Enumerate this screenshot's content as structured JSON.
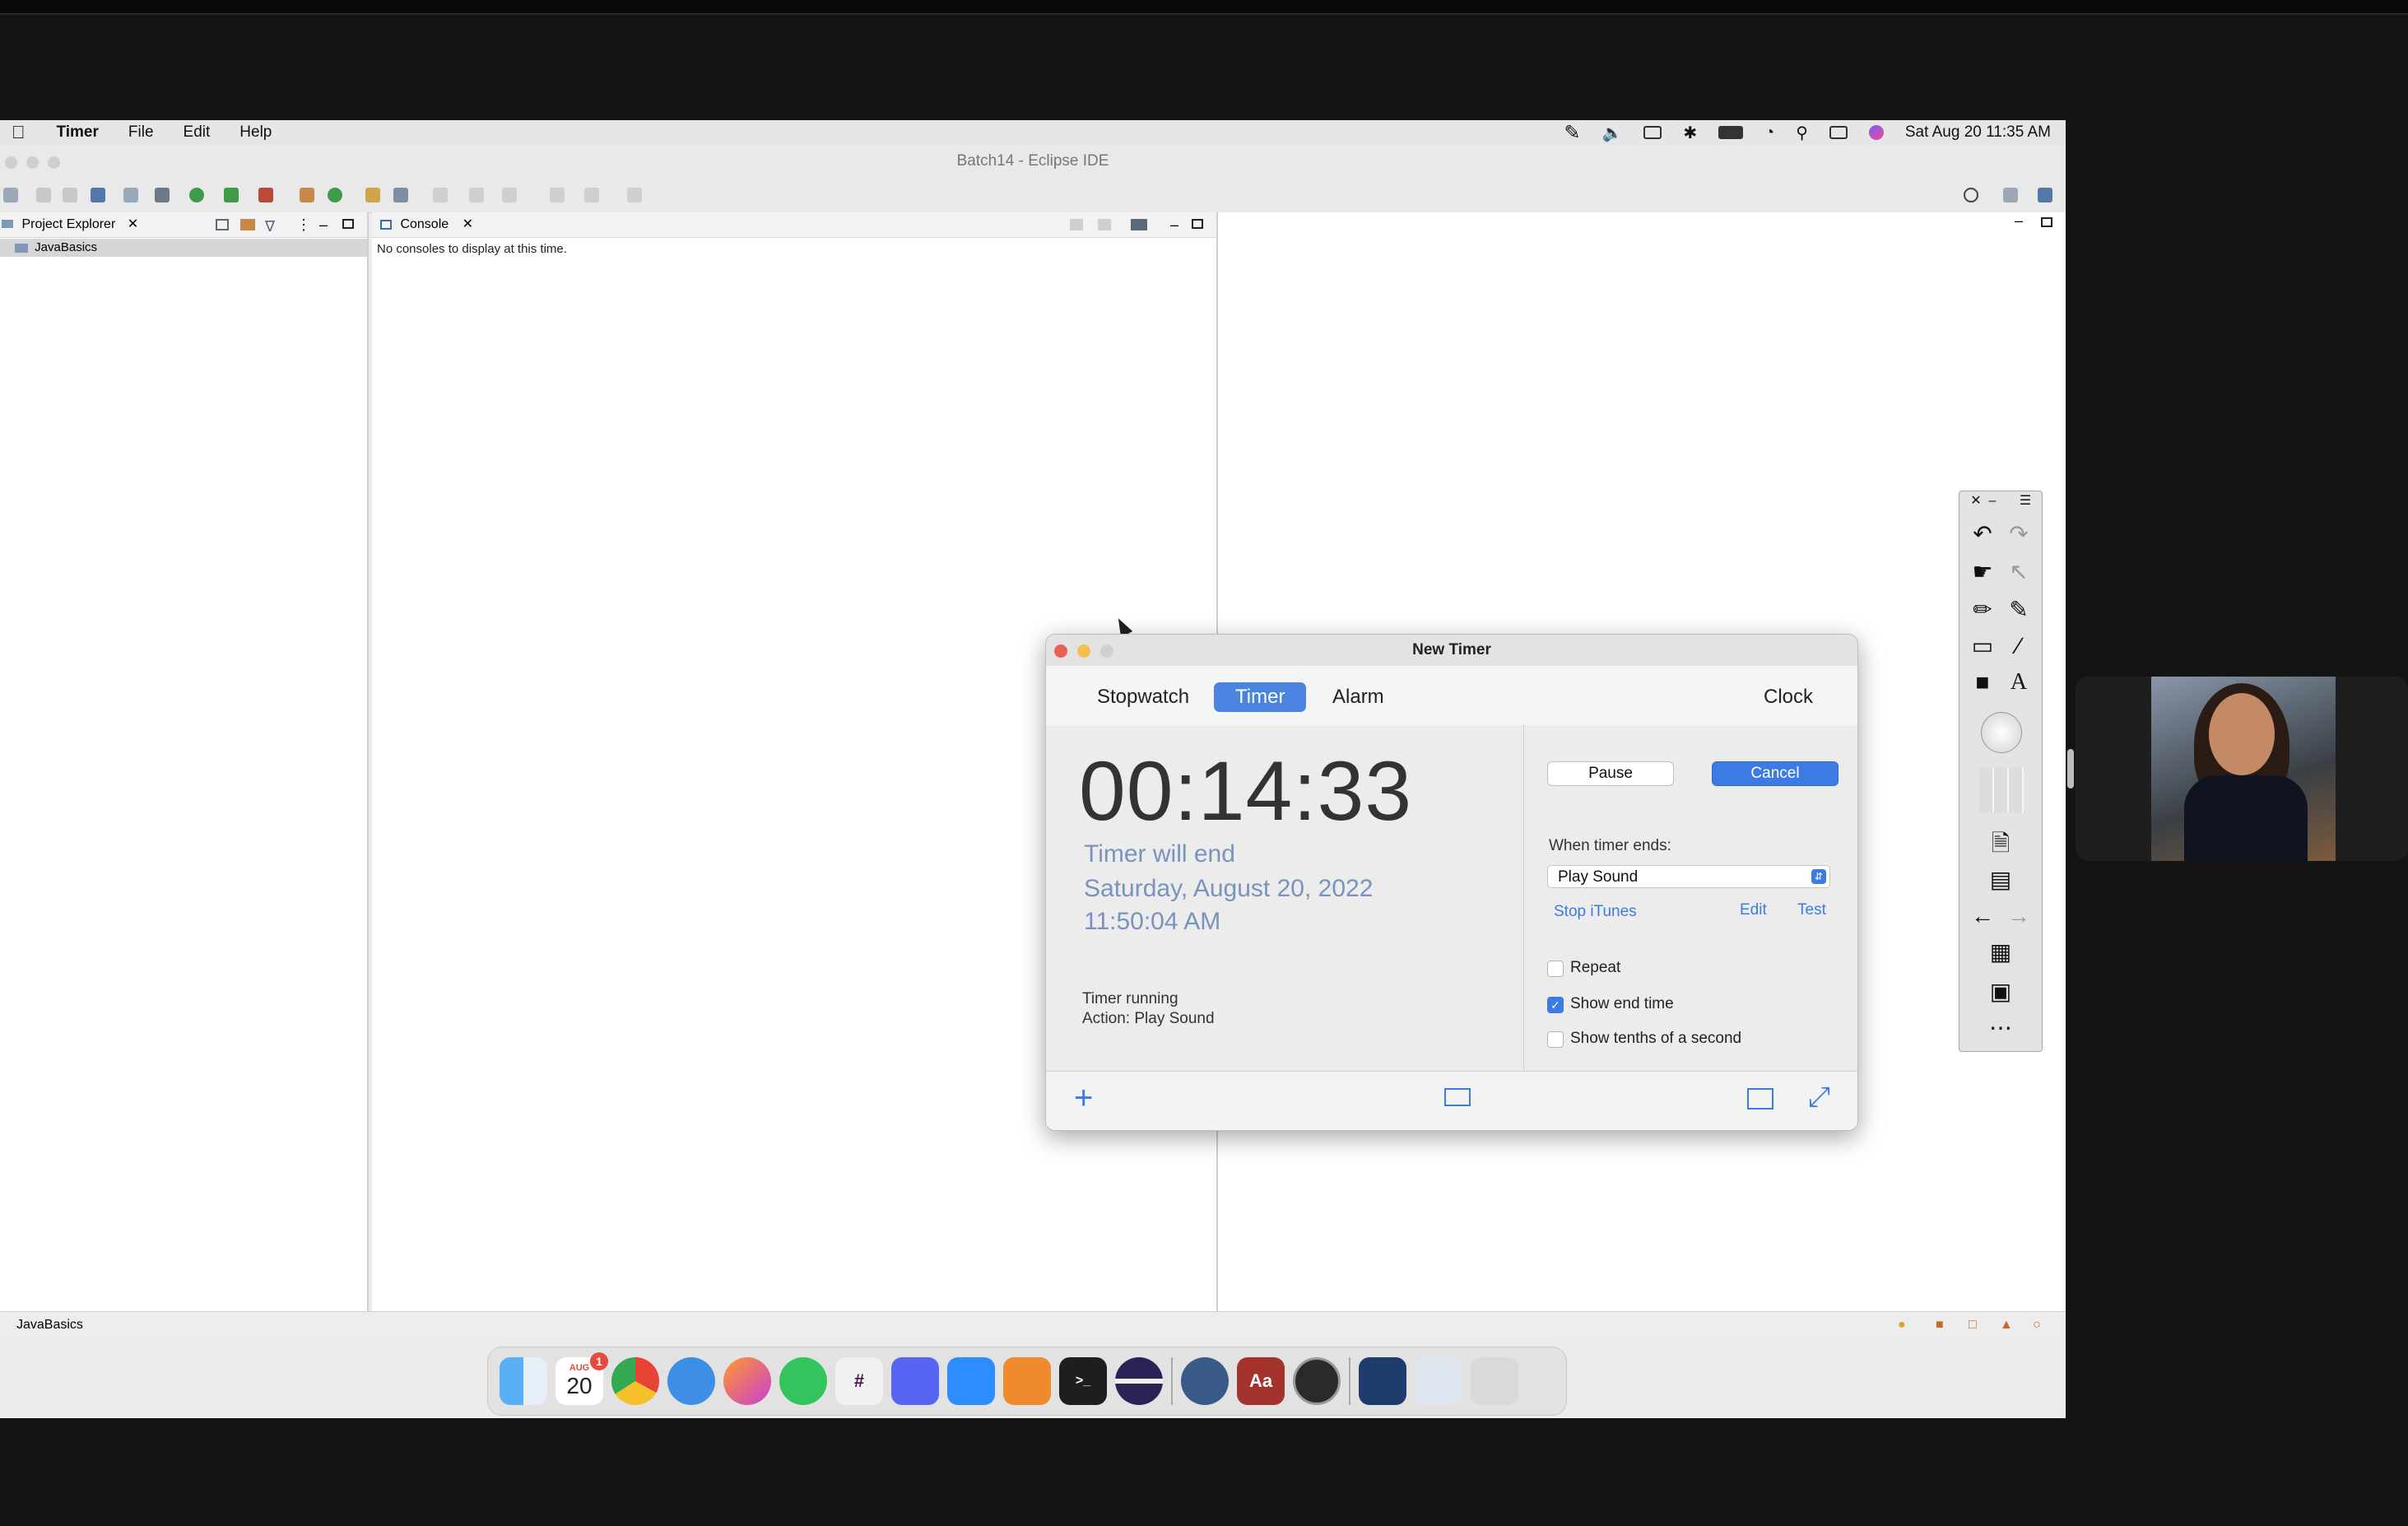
{
  "menubar": {
    "app": "Timer",
    "items": [
      "File",
      "Edit",
      "Help"
    ],
    "datetime": "Sat Aug 20  11:35 AM"
  },
  "eclipse": {
    "window_title": "Batch14 - Eclipse IDE",
    "project_explorer_tab": "Project Explorer",
    "project_item": "JavaBasics",
    "console_tab": "Console",
    "console_message": "No consoles to display at this time.",
    "status_item": "JavaBasics"
  },
  "timer_window": {
    "title": "New Timer",
    "tabs": [
      "Stopwatch",
      "Timer",
      "Alarm"
    ],
    "clock_tab": "Clock",
    "countdown": "00:14:33",
    "end_label": "Timer will end",
    "end_date": "Saturday, August 20, 2022",
    "end_time": "11:50:04 AM",
    "status": "Timer running",
    "action": "Action: Play Sound",
    "pause_label": "Pause",
    "cancel_label": "Cancel",
    "when_ends_label": "When timer ends:",
    "sound_select": "Play Sound",
    "stop_itunes": "Stop iTunes",
    "edit_link": "Edit",
    "test_link": "Test",
    "repeat_label": "Repeat",
    "show_end_label": "Show end time",
    "show_tenths_label": "Show tenths of a second",
    "repeat_checked": false,
    "show_end_checked": true,
    "show_tenths_checked": false
  },
  "dock": {
    "calendar_month": "AUG",
    "calendar_day": "20",
    "calendar_badge": "1",
    "dictionary_label": "Aa"
  },
  "colors": {
    "accent": "#4a84e0",
    "close": "#ec5f57",
    "minimize": "#f4bf4f"
  }
}
